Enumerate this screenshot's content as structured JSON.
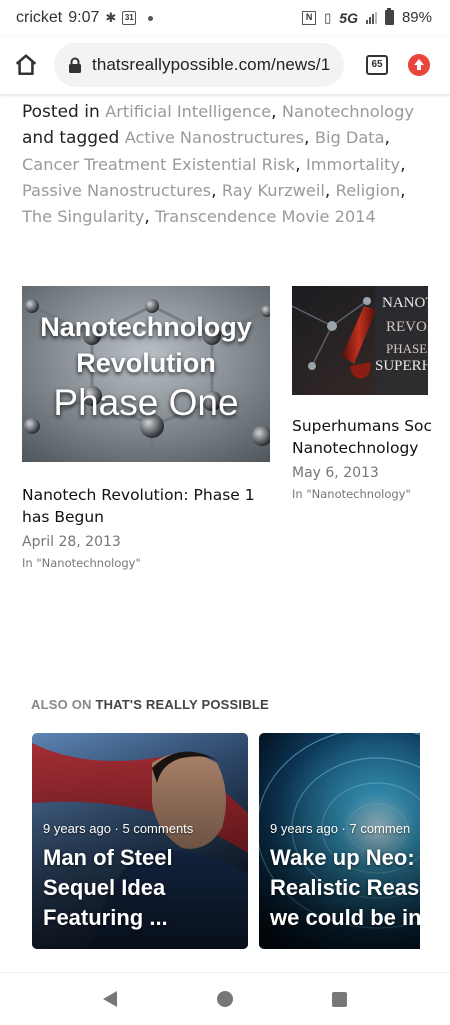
{
  "status_bar": {
    "carrier": "cricket",
    "time": "9:07",
    "calendar_day": "31",
    "network": "5G",
    "battery": "89%",
    "icons": [
      "settings-icon",
      "calendar-icon",
      "nfc-icon",
      "vibrate-icon",
      "signal-icon",
      "battery-icon"
    ]
  },
  "browser": {
    "url": "thatsreallypossible.com/news/1",
    "tab_count": "65",
    "icons": [
      "home-icon",
      "lock-icon",
      "tabs-icon",
      "update-icon"
    ]
  },
  "meta": {
    "posted_in_label": "Posted in",
    "categories": [
      "Artificial Intelligence",
      "Nanotechnology"
    ],
    "tagged_label": "and tagged",
    "tags": [
      "Active Nanostructures",
      "Big Data",
      "Cancer Treatment",
      "Existential Risk",
      "Immortality",
      "Passive Nanostructures",
      "Ray Kurzweil",
      "Religion",
      "The Singularity",
      "Transcendence Movie 2014"
    ]
  },
  "related_posts": [
    {
      "image_caption": [
        "Nanotechnology",
        "Revolution",
        "Phase One"
      ],
      "title_lines": [
        "Nanotech Revolution: Phase 1",
        "has Begun"
      ],
      "date": "April 28, 2013",
      "category": "In \"Nanotechnology\""
    },
    {
      "image_caption": [
        "NANOT",
        "REVOL",
        "PHASE",
        "SUPERH"
      ],
      "title_lines": [
        "Superhumans Soc",
        "Nanotechnology"
      ],
      "date": "May 6, 2013",
      "category": "In \"Nanotechnology\""
    }
  ],
  "also_on": {
    "label": "ALSO ON",
    "site": "THAT'S REALLY POSSIBLE"
  },
  "recommendations": [
    {
      "meta": "9 years ago · 5 comments",
      "title_lines": [
        "Man of Steel",
        "Sequel Idea",
        "Featuring ..."
      ]
    },
    {
      "meta": "9 years ago · 7 commen",
      "title_lines": [
        "Wake up Neo:",
        "Realistic Reas",
        "we could be in"
      ]
    }
  ],
  "nav": {
    "icons": [
      "back-icon",
      "home-circle-icon",
      "recents-icon"
    ]
  }
}
